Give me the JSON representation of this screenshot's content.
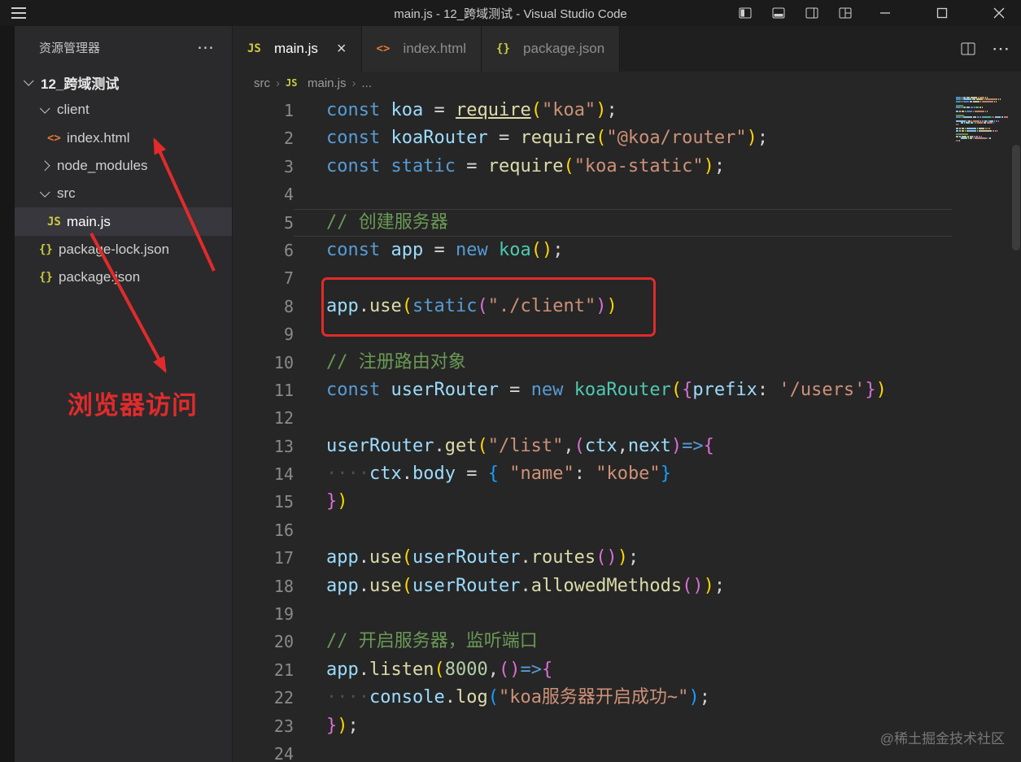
{
  "window": {
    "title": "main.js - 12_跨域测试 - Visual Studio Code"
  },
  "icons": {
    "more": "⋯"
  },
  "icon_glyphs": {
    "js": "JS",
    "html": "<>",
    "json": "{}"
  },
  "sidebar": {
    "title": "资源管理器",
    "tree": [
      {
        "label": "12_跨域测试",
        "kind": "root",
        "state": "expanded",
        "indent": 0,
        "selected": false
      },
      {
        "label": "client",
        "kind": "folder",
        "state": "expanded",
        "indent": 1,
        "selected": false
      },
      {
        "label": "index.html",
        "kind": "html",
        "state": "none",
        "indent": 2,
        "selected": false
      },
      {
        "label": "node_modules",
        "kind": "folder",
        "state": "collapsed",
        "indent": 1,
        "selected": false
      },
      {
        "label": "src",
        "kind": "folder",
        "state": "expanded",
        "indent": 1,
        "selected": false
      },
      {
        "label": "main.js",
        "kind": "js",
        "state": "none",
        "indent": 2,
        "selected": true
      },
      {
        "label": "package-lock.json",
        "kind": "json",
        "state": "none",
        "indent": 1,
        "selected": false
      },
      {
        "label": "package.json",
        "kind": "json",
        "state": "none",
        "indent": 1,
        "selected": false
      }
    ]
  },
  "tabs": [
    {
      "label": "main.js",
      "icon": "js",
      "active": true
    },
    {
      "label": "index.html",
      "icon": "html",
      "active": false
    },
    {
      "label": "package.json",
      "icon": "json",
      "active": false
    }
  ],
  "breadcrumb": {
    "sep": "›",
    "items": [
      {
        "label": "src"
      },
      {
        "label": "main.js",
        "icon": "js"
      },
      {
        "label": "..."
      }
    ]
  },
  "editor": {
    "active_line": 5,
    "lines": [
      [
        [
          "kw",
          "const"
        ],
        [
          "pu",
          " "
        ],
        [
          "var",
          "koa"
        ],
        [
          "pu",
          " = "
        ],
        [
          "fnu",
          "require"
        ],
        [
          "b1",
          "("
        ],
        [
          "str",
          "\"koa\""
        ],
        [
          "b1",
          ")"
        ],
        [
          "pu",
          ";"
        ]
      ],
      [
        [
          "kw",
          "const"
        ],
        [
          "pu",
          " "
        ],
        [
          "var",
          "koaRouter"
        ],
        [
          "pu",
          " = "
        ],
        [
          "fn",
          "require"
        ],
        [
          "b1",
          "("
        ],
        [
          "str",
          "\"@koa/router\""
        ],
        [
          "b1",
          ")"
        ],
        [
          "pu",
          ";"
        ]
      ],
      [
        [
          "kw",
          "const"
        ],
        [
          "pu",
          " "
        ],
        [
          "kw",
          "static"
        ],
        [
          "pu",
          " = "
        ],
        [
          "fn",
          "require"
        ],
        [
          "b1",
          "("
        ],
        [
          "str",
          "\"koa-static\""
        ],
        [
          "b1",
          ")"
        ],
        [
          "pu",
          ";"
        ]
      ],
      [],
      [
        [
          "com",
          "// 创建服务器"
        ]
      ],
      [
        [
          "kw",
          "const"
        ],
        [
          "pu",
          " "
        ],
        [
          "var",
          "app"
        ],
        [
          "pu",
          " = "
        ],
        [
          "kw",
          "new"
        ],
        [
          "pu",
          " "
        ],
        [
          "cls",
          "koa"
        ],
        [
          "b1",
          "()"
        ],
        [
          "pu",
          ";"
        ]
      ],
      [],
      [
        [
          "var",
          "app"
        ],
        [
          "pu",
          "."
        ],
        [
          "fn",
          "use"
        ],
        [
          "b1",
          "("
        ],
        [
          "kw",
          "static"
        ],
        [
          "b2",
          "("
        ],
        [
          "str",
          "\"./client\""
        ],
        [
          "b2",
          ")"
        ],
        [
          "b1",
          ")"
        ]
      ],
      [],
      [
        [
          "com",
          "// 注册路由对象"
        ]
      ],
      [
        [
          "kw",
          "const"
        ],
        [
          "pu",
          " "
        ],
        [
          "var",
          "userRouter"
        ],
        [
          "pu",
          " = "
        ],
        [
          "kw",
          "new"
        ],
        [
          "pu",
          " "
        ],
        [
          "cls",
          "koaRouter"
        ],
        [
          "b1",
          "("
        ],
        [
          "b2",
          "{"
        ],
        [
          "pr",
          "prefix"
        ],
        [
          "pu",
          ": "
        ],
        [
          "str",
          "'/users'"
        ],
        [
          "b2",
          "}"
        ],
        [
          "b1",
          ")"
        ]
      ],
      [],
      [
        [
          "var",
          "userRouter"
        ],
        [
          "pu",
          "."
        ],
        [
          "fn",
          "get"
        ],
        [
          "b1",
          "("
        ],
        [
          "str",
          "\"/list\""
        ],
        [
          "pu",
          ","
        ],
        [
          "b2",
          "("
        ],
        [
          "var",
          "ctx"
        ],
        [
          "pu",
          ","
        ],
        [
          "var",
          "next"
        ],
        [
          "b2",
          ")"
        ],
        [
          "kw",
          "=>"
        ],
        [
          "b2",
          "{"
        ]
      ],
      [
        [
          "ws",
          "····"
        ],
        [
          "var",
          "ctx"
        ],
        [
          "pu",
          "."
        ],
        [
          "pr",
          "body"
        ],
        [
          "pu",
          " = "
        ],
        [
          "b3",
          "{"
        ],
        [
          "pu",
          " "
        ],
        [
          "str",
          "\"name\""
        ],
        [
          "pu",
          ": "
        ],
        [
          "str",
          "\"kobe\""
        ],
        [
          "b3",
          "}"
        ]
      ],
      [
        [
          "b2",
          "}"
        ],
        [
          "b1",
          ")"
        ]
      ],
      [],
      [
        [
          "var",
          "app"
        ],
        [
          "pu",
          "."
        ],
        [
          "fn",
          "use"
        ],
        [
          "b1",
          "("
        ],
        [
          "var",
          "userRouter"
        ],
        [
          "pu",
          "."
        ],
        [
          "fn",
          "routes"
        ],
        [
          "b2",
          "()"
        ],
        [
          "b1",
          ")"
        ],
        [
          "pu",
          ";"
        ]
      ],
      [
        [
          "var",
          "app"
        ],
        [
          "pu",
          "."
        ],
        [
          "fn",
          "use"
        ],
        [
          "b1",
          "("
        ],
        [
          "var",
          "userRouter"
        ],
        [
          "pu",
          "."
        ],
        [
          "fn",
          "allowedMethods"
        ],
        [
          "b2",
          "()"
        ],
        [
          "b1",
          ")"
        ],
        [
          "pu",
          ";"
        ]
      ],
      [],
      [
        [
          "com",
          "// 开启服务器，监听端口"
        ]
      ],
      [
        [
          "var",
          "app"
        ],
        [
          "pu",
          "."
        ],
        [
          "fn",
          "listen"
        ],
        [
          "b1",
          "("
        ],
        [
          "num",
          "8000"
        ],
        [
          "pu",
          ","
        ],
        [
          "b2",
          "()"
        ],
        [
          "kw",
          "=>"
        ],
        [
          "b2",
          "{"
        ]
      ],
      [
        [
          "ws",
          "····"
        ],
        [
          "var",
          "console"
        ],
        [
          "pu",
          "."
        ],
        [
          "fn",
          "log"
        ],
        [
          "b3",
          "("
        ],
        [
          "str",
          "\"koa服务器开启成功~\""
        ],
        [
          "b3",
          ")"
        ],
        [
          "pu",
          ";"
        ]
      ],
      [
        [
          "b2",
          "}"
        ],
        [
          "b1",
          ")"
        ],
        [
          "pu",
          ";"
        ]
      ],
      []
    ]
  },
  "annotations": {
    "label": "浏览器访问"
  },
  "watermark": "@稀土掘金技术社区",
  "palette": {
    "kw": "#569cd6",
    "var": "#9cdcfe",
    "cls": "#4ec9b0",
    "fn": "#dcdcaa",
    "fnu": "#dcdcaa",
    "str": "#ce9178",
    "com": "#6a9955",
    "num": "#b5cea8",
    "pr": "#9cdcfe",
    "pu": "#d4d4d4",
    "b1": "#ffd700",
    "b2": "#da70d6",
    "b3": "#179fff",
    "ws": "#4e4e4e",
    "red": "#e12b2b",
    "js": "#cbcb41",
    "html": "#e37933",
    "json": "#cbcb41"
  }
}
